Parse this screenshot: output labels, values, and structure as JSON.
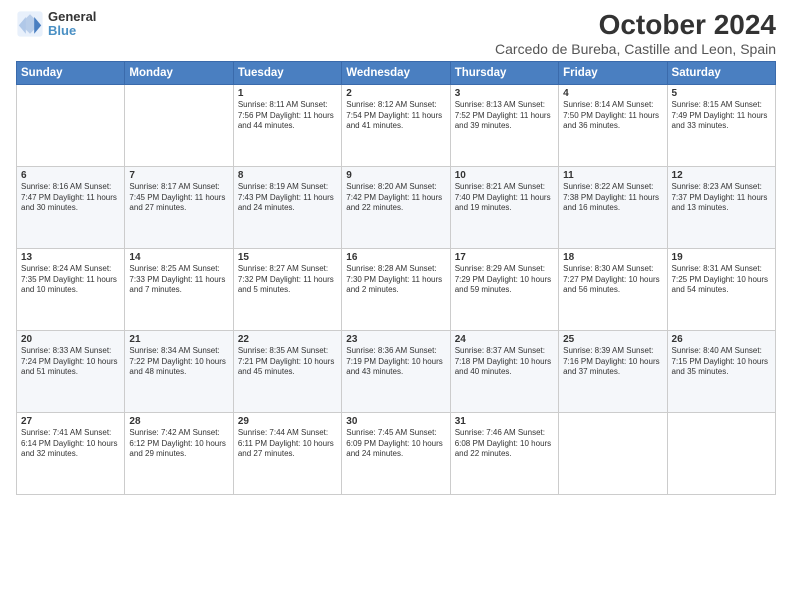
{
  "logo": {
    "line1": "General",
    "line2": "Blue"
  },
  "title": "October 2024",
  "subtitle": "Carcedo de Bureba, Castille and Leon, Spain",
  "weekdays": [
    "Sunday",
    "Monday",
    "Tuesday",
    "Wednesday",
    "Thursday",
    "Friday",
    "Saturday"
  ],
  "weeks": [
    [
      {
        "day": "",
        "content": ""
      },
      {
        "day": "",
        "content": ""
      },
      {
        "day": "1",
        "content": "Sunrise: 8:11 AM\nSunset: 7:56 PM\nDaylight: 11 hours and 44 minutes."
      },
      {
        "day": "2",
        "content": "Sunrise: 8:12 AM\nSunset: 7:54 PM\nDaylight: 11 hours and 41 minutes."
      },
      {
        "day": "3",
        "content": "Sunrise: 8:13 AM\nSunset: 7:52 PM\nDaylight: 11 hours and 39 minutes."
      },
      {
        "day": "4",
        "content": "Sunrise: 8:14 AM\nSunset: 7:50 PM\nDaylight: 11 hours and 36 minutes."
      },
      {
        "day": "5",
        "content": "Sunrise: 8:15 AM\nSunset: 7:49 PM\nDaylight: 11 hours and 33 minutes."
      }
    ],
    [
      {
        "day": "6",
        "content": "Sunrise: 8:16 AM\nSunset: 7:47 PM\nDaylight: 11 hours and 30 minutes."
      },
      {
        "day": "7",
        "content": "Sunrise: 8:17 AM\nSunset: 7:45 PM\nDaylight: 11 hours and 27 minutes."
      },
      {
        "day": "8",
        "content": "Sunrise: 8:19 AM\nSunset: 7:43 PM\nDaylight: 11 hours and 24 minutes."
      },
      {
        "day": "9",
        "content": "Sunrise: 8:20 AM\nSunset: 7:42 PM\nDaylight: 11 hours and 22 minutes."
      },
      {
        "day": "10",
        "content": "Sunrise: 8:21 AM\nSunset: 7:40 PM\nDaylight: 11 hours and 19 minutes."
      },
      {
        "day": "11",
        "content": "Sunrise: 8:22 AM\nSunset: 7:38 PM\nDaylight: 11 hours and 16 minutes."
      },
      {
        "day": "12",
        "content": "Sunrise: 8:23 AM\nSunset: 7:37 PM\nDaylight: 11 hours and 13 minutes."
      }
    ],
    [
      {
        "day": "13",
        "content": "Sunrise: 8:24 AM\nSunset: 7:35 PM\nDaylight: 11 hours and 10 minutes."
      },
      {
        "day": "14",
        "content": "Sunrise: 8:25 AM\nSunset: 7:33 PM\nDaylight: 11 hours and 7 minutes."
      },
      {
        "day": "15",
        "content": "Sunrise: 8:27 AM\nSunset: 7:32 PM\nDaylight: 11 hours and 5 minutes."
      },
      {
        "day": "16",
        "content": "Sunrise: 8:28 AM\nSunset: 7:30 PM\nDaylight: 11 hours and 2 minutes."
      },
      {
        "day": "17",
        "content": "Sunrise: 8:29 AM\nSunset: 7:29 PM\nDaylight: 10 hours and 59 minutes."
      },
      {
        "day": "18",
        "content": "Sunrise: 8:30 AM\nSunset: 7:27 PM\nDaylight: 10 hours and 56 minutes."
      },
      {
        "day": "19",
        "content": "Sunrise: 8:31 AM\nSunset: 7:25 PM\nDaylight: 10 hours and 54 minutes."
      }
    ],
    [
      {
        "day": "20",
        "content": "Sunrise: 8:33 AM\nSunset: 7:24 PM\nDaylight: 10 hours and 51 minutes."
      },
      {
        "day": "21",
        "content": "Sunrise: 8:34 AM\nSunset: 7:22 PM\nDaylight: 10 hours and 48 minutes."
      },
      {
        "day": "22",
        "content": "Sunrise: 8:35 AM\nSunset: 7:21 PM\nDaylight: 10 hours and 45 minutes."
      },
      {
        "day": "23",
        "content": "Sunrise: 8:36 AM\nSunset: 7:19 PM\nDaylight: 10 hours and 43 minutes."
      },
      {
        "day": "24",
        "content": "Sunrise: 8:37 AM\nSunset: 7:18 PM\nDaylight: 10 hours and 40 minutes."
      },
      {
        "day": "25",
        "content": "Sunrise: 8:39 AM\nSunset: 7:16 PM\nDaylight: 10 hours and 37 minutes."
      },
      {
        "day": "26",
        "content": "Sunrise: 8:40 AM\nSunset: 7:15 PM\nDaylight: 10 hours and 35 minutes."
      }
    ],
    [
      {
        "day": "27",
        "content": "Sunrise: 7:41 AM\nSunset: 6:14 PM\nDaylight: 10 hours and 32 minutes."
      },
      {
        "day": "28",
        "content": "Sunrise: 7:42 AM\nSunset: 6:12 PM\nDaylight: 10 hours and 29 minutes."
      },
      {
        "day": "29",
        "content": "Sunrise: 7:44 AM\nSunset: 6:11 PM\nDaylight: 10 hours and 27 minutes."
      },
      {
        "day": "30",
        "content": "Sunrise: 7:45 AM\nSunset: 6:09 PM\nDaylight: 10 hours and 24 minutes."
      },
      {
        "day": "31",
        "content": "Sunrise: 7:46 AM\nSunset: 6:08 PM\nDaylight: 10 hours and 22 minutes."
      },
      {
        "day": "",
        "content": ""
      },
      {
        "day": "",
        "content": ""
      }
    ]
  ]
}
